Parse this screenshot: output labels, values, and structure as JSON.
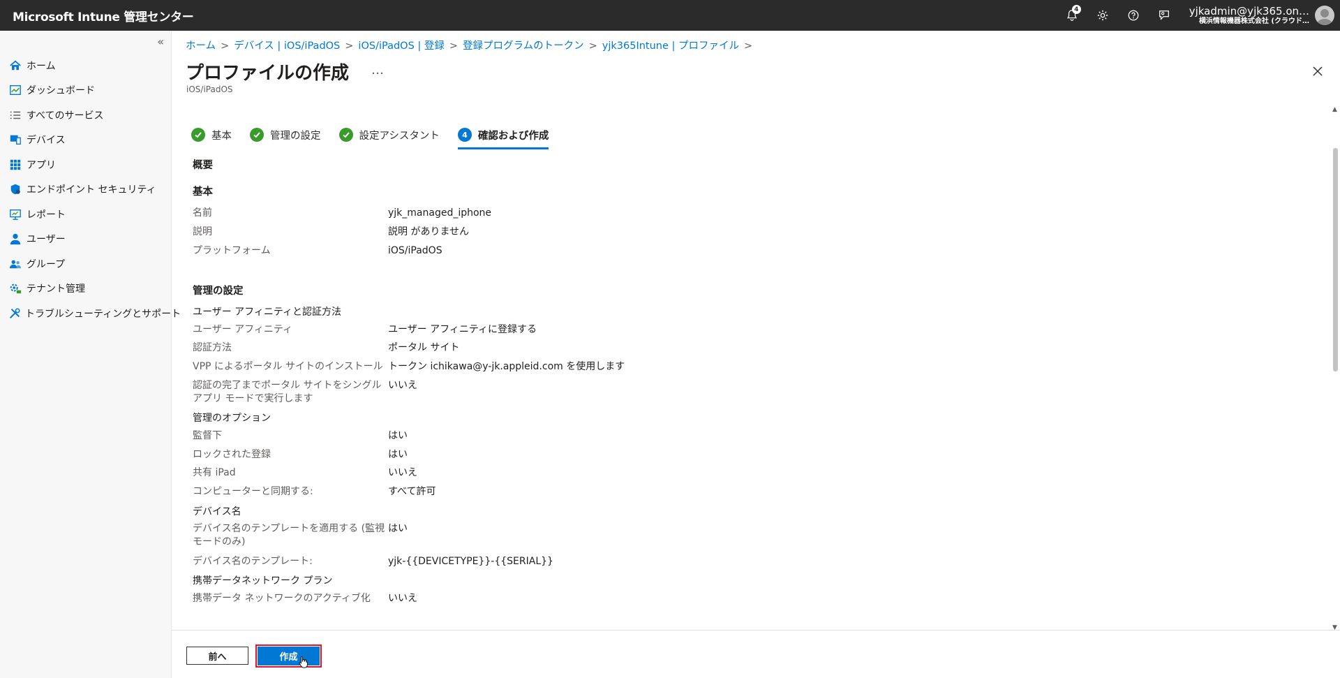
{
  "app": {
    "title": "Microsoft Intune 管理センター",
    "notification_count": "4",
    "account_email": "yjkadmin@yjk365.on…",
    "account_org": "横浜情報機器株式会社 (クラウド…"
  },
  "sidebar": {
    "collapse_glyph": "«",
    "items": [
      {
        "label": "ホーム",
        "icon": "home-icon"
      },
      {
        "label": "ダッシュボード",
        "icon": "dashboard-icon"
      },
      {
        "label": "すべてのサービス",
        "icon": "list-icon"
      },
      {
        "label": "デバイス",
        "icon": "devices-icon"
      },
      {
        "label": "アプリ",
        "icon": "apps-icon"
      },
      {
        "label": "エンドポイント セキュリティ",
        "icon": "shield-icon"
      },
      {
        "label": "レポート",
        "icon": "reports-icon"
      },
      {
        "label": "ユーザー",
        "icon": "user-icon"
      },
      {
        "label": "グループ",
        "icon": "group-icon"
      },
      {
        "label": "テナント管理",
        "icon": "tenant-icon"
      },
      {
        "label": "トラブルシューティングとサポート",
        "icon": "tools-icon"
      }
    ]
  },
  "breadcrumb": [
    "ホーム",
    "デバイス | iOS/iPadOS",
    "iOS/iPadOS | 登録",
    "登録プログラムのトークン",
    "yjk365Intune | プロファイル"
  ],
  "page": {
    "title": "プロファイルの作成",
    "more": "…",
    "subtitle": "iOS/iPadOS"
  },
  "steps": [
    {
      "label": "基本",
      "state": "done"
    },
    {
      "label": "管理の設定",
      "state": "done"
    },
    {
      "label": "設定アシスタント",
      "state": "done"
    },
    {
      "label": "確認および作成",
      "state": "active",
      "number": "4"
    }
  ],
  "summary": {
    "heading": "概要",
    "basics": {
      "heading": "基本",
      "rows": [
        {
          "k": "名前",
          "v": "yjk_managed_iphone"
        },
        {
          "k": "説明",
          "v": "説明 がありません"
        },
        {
          "k": "プラットフォーム",
          "v": "iOS/iPadOS"
        }
      ]
    },
    "management": {
      "heading": "管理の設定",
      "affinity_heading": "ユーザー アフィニティと認証方法",
      "affinity_rows": [
        {
          "k": "ユーザー アフィニティ",
          "v": "ユーザー アフィニティに登録する"
        },
        {
          "k": "認証方法",
          "v": "ポータル サイト"
        },
        {
          "k": "VPP によるポータル サイトのインストール",
          "v": "トークン ichikawa@y-jk.appleid.com を使用します"
        },
        {
          "k": "認証の完了までポータル サイトをシングル アプリ モードで実行します",
          "v": "いいえ"
        }
      ],
      "options_heading": "管理のオプション",
      "options_rows": [
        {
          "k": "監督下",
          "v": "はい"
        },
        {
          "k": "ロックされた登録",
          "v": "はい"
        },
        {
          "k": "共有 iPad",
          "v": "いいえ"
        },
        {
          "k": "コンピューターと同期する:",
          "v": "すべて許可"
        }
      ],
      "device_name_heading": "デバイス名",
      "device_name_rows": [
        {
          "k": "デバイス名のテンプレートを適用する (監視モードのみ)",
          "v": "はい"
        },
        {
          "k": "デバイス名のテンプレート:",
          "v": "yjk-{{DEVICETYPE}}-{{SERIAL}}"
        }
      ],
      "cellular_heading": "携帯データネットワーク プラン",
      "cellular_rows": [
        {
          "k": "携帯データ ネットワークのアクティブ化",
          "v": "いいえ"
        }
      ]
    }
  },
  "footer": {
    "prev_label": "前へ",
    "create_label": "作成"
  },
  "colors": {
    "accent": "#0078d4",
    "success": "#3a9b2d",
    "highlight": "#e8112d",
    "topbar": "#2b2b2b"
  }
}
